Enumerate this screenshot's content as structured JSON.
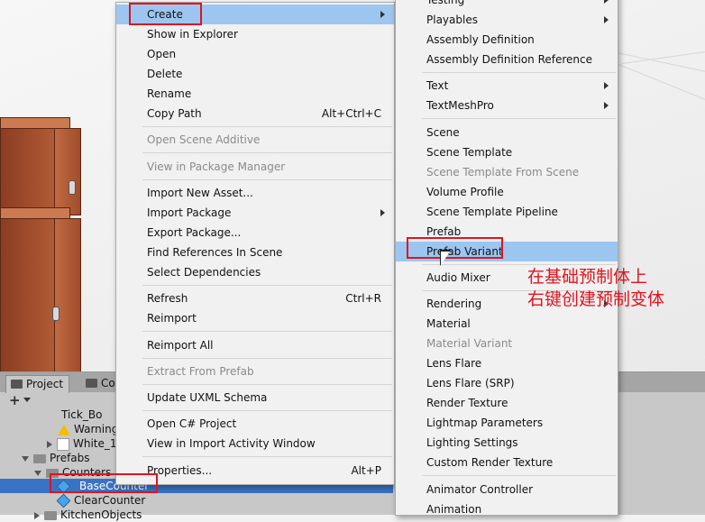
{
  "menu_left": {
    "items": [
      {
        "label": "Create",
        "submenu": true,
        "highlight": true
      },
      {
        "label": "Show in Explorer"
      },
      {
        "label": "Open"
      },
      {
        "label": "Delete"
      },
      {
        "label": "Rename"
      },
      {
        "label": "Copy Path",
        "shortcut": "Alt+Ctrl+C"
      },
      {
        "sep": true
      },
      {
        "label": "Open Scene Additive",
        "disabled": true
      },
      {
        "sep": true
      },
      {
        "label": "View in Package Manager",
        "disabled": true
      },
      {
        "sep": true
      },
      {
        "label": "Import New Asset..."
      },
      {
        "label": "Import Package",
        "submenu": true
      },
      {
        "label": "Export Package..."
      },
      {
        "label": "Find References In Scene"
      },
      {
        "label": "Select Dependencies"
      },
      {
        "sep": true
      },
      {
        "label": "Refresh",
        "shortcut": "Ctrl+R"
      },
      {
        "label": "Reimport"
      },
      {
        "sep": true
      },
      {
        "label": "Reimport All"
      },
      {
        "sep": true
      },
      {
        "label": "Extract From Prefab",
        "disabled": true
      },
      {
        "sep": true
      },
      {
        "label": "Update UXML Schema"
      },
      {
        "sep": true
      },
      {
        "label": "Open C# Project"
      },
      {
        "label": "View in Import Activity Window"
      },
      {
        "sep": true
      },
      {
        "label": "Properties...",
        "shortcut": "Alt+P"
      }
    ]
  },
  "menu_right": {
    "items": [
      {
        "label": "Testing",
        "submenu": true
      },
      {
        "label": "Playables",
        "submenu": true
      },
      {
        "label": "Assembly Definition"
      },
      {
        "label": "Assembly Definition Reference"
      },
      {
        "sep": true
      },
      {
        "label": "Text",
        "submenu": true
      },
      {
        "label": "TextMeshPro",
        "submenu": true
      },
      {
        "sep": true
      },
      {
        "label": "Scene"
      },
      {
        "label": "Scene Template"
      },
      {
        "label": "Scene Template From Scene",
        "disabled": true
      },
      {
        "label": "Volume Profile"
      },
      {
        "label": "Scene Template Pipeline"
      },
      {
        "label": "Prefab"
      },
      {
        "label": "Prefab Variant",
        "highlight": true
      },
      {
        "sep": true
      },
      {
        "label": "Audio Mixer"
      },
      {
        "sep": true
      },
      {
        "label": "Rendering",
        "submenu": true
      },
      {
        "label": "Material"
      },
      {
        "label": "Material Variant",
        "disabled": true
      },
      {
        "label": "Lens Flare"
      },
      {
        "label": "Lens Flare (SRP)"
      },
      {
        "label": "Render Texture"
      },
      {
        "label": "Lightmap Parameters"
      },
      {
        "label": "Lighting Settings"
      },
      {
        "label": "Custom Render Texture"
      },
      {
        "sep": true
      },
      {
        "label": "Animator Controller"
      },
      {
        "label": "Animation"
      }
    ]
  },
  "project_panel": {
    "tabs": [
      "Project",
      "Co"
    ],
    "tree": [
      {
        "label": "Tick_Bo",
        "type": "asset",
        "indent": 64
      },
      {
        "label": "Warning",
        "type": "warning",
        "indent": 64
      },
      {
        "label": "White_1",
        "type": "white",
        "indent": 52,
        "arrow": "right"
      },
      {
        "label": "Prefabs",
        "type": "folder",
        "indent": 24,
        "arrow": "down"
      },
      {
        "label": "Counters",
        "type": "folder",
        "indent": 38,
        "arrow": "down"
      },
      {
        "label": "_BaseCounter",
        "type": "prefab",
        "indent": 64,
        "selected": true
      },
      {
        "label": "ClearCounter",
        "type": "prefab",
        "indent": 64
      },
      {
        "label": "KitchenObjects",
        "type": "folder",
        "indent": 38,
        "arrow": "right"
      }
    ]
  },
  "annotation": {
    "line1": "在基础预制体上",
    "line2": "右键创建预制变体",
    "color": "#e0141e"
  },
  "colors": {
    "menu_highlight": "#9cc5ef",
    "selection": "#3a72c4",
    "cabinet": "#a84f2c"
  }
}
